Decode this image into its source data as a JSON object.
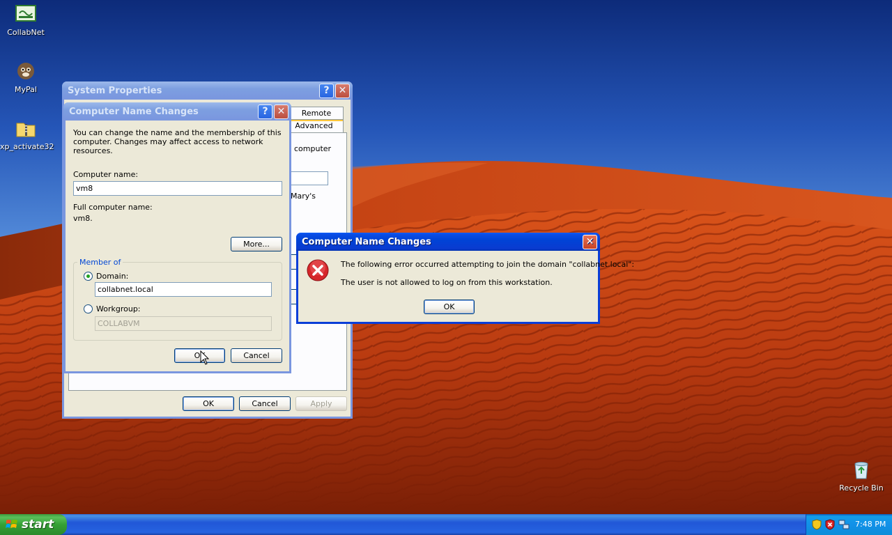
{
  "desktop": {
    "icons": [
      {
        "label": "CollabNet",
        "icon": "collabnet-shortcut-icon"
      },
      {
        "label": "MyPal",
        "icon": "mypal-browser-icon"
      },
      {
        "label": "xp_activate32",
        "icon": "zip-folder-icon"
      },
      {
        "label": "Recycle Bin",
        "icon": "recycle-bin-icon"
      }
    ]
  },
  "system_properties": {
    "title": "System Properties",
    "help_glyph": "?",
    "close_glyph": "✕",
    "tabs": [
      "Remote",
      "Advanced"
    ],
    "partial_text_1": "computer",
    "partial_text_2": "Mary's",
    "ok_label": "OK",
    "cancel_label": "Cancel",
    "apply_label": "Apply"
  },
  "name_changes_dialog": {
    "title": "Computer Name Changes",
    "description": "You can change the name and the membership of this computer. Changes may affect access to network resources.",
    "computer_name_label": "Computer name:",
    "computer_name_value": "vm8",
    "full_name_label": "Full computer name:",
    "full_name_value": "vm8.",
    "more_label": "More...",
    "member_of_label": "Member of",
    "domain_label": "Domain:",
    "domain_value": "collabnet.local",
    "workgroup_label": "Workgroup:",
    "workgroup_value": "COLLABVM",
    "selected_membership": "Domain",
    "ok_label": "OK",
    "cancel_label": "Cancel"
  },
  "error_dialog": {
    "title": "Computer Name Changes",
    "icon": "error-icon",
    "message": "The following error occurred attempting to join the domain \"collabnet.local\":",
    "detail": "The user is not allowed to log on from this workstation.",
    "ok_label": "OK"
  },
  "taskbar": {
    "start_label": "start",
    "clock": "7:48 PM",
    "tray_icons": [
      "security-shield-icon",
      "security-alert-icon",
      "network-icon"
    ]
  },
  "colors": {
    "title_active": "#0a3ed8",
    "title_inactive": "#7a96df",
    "dialog_bg": "#ece9d8",
    "sand": "#c9400f",
    "sky": "#2556b8"
  }
}
